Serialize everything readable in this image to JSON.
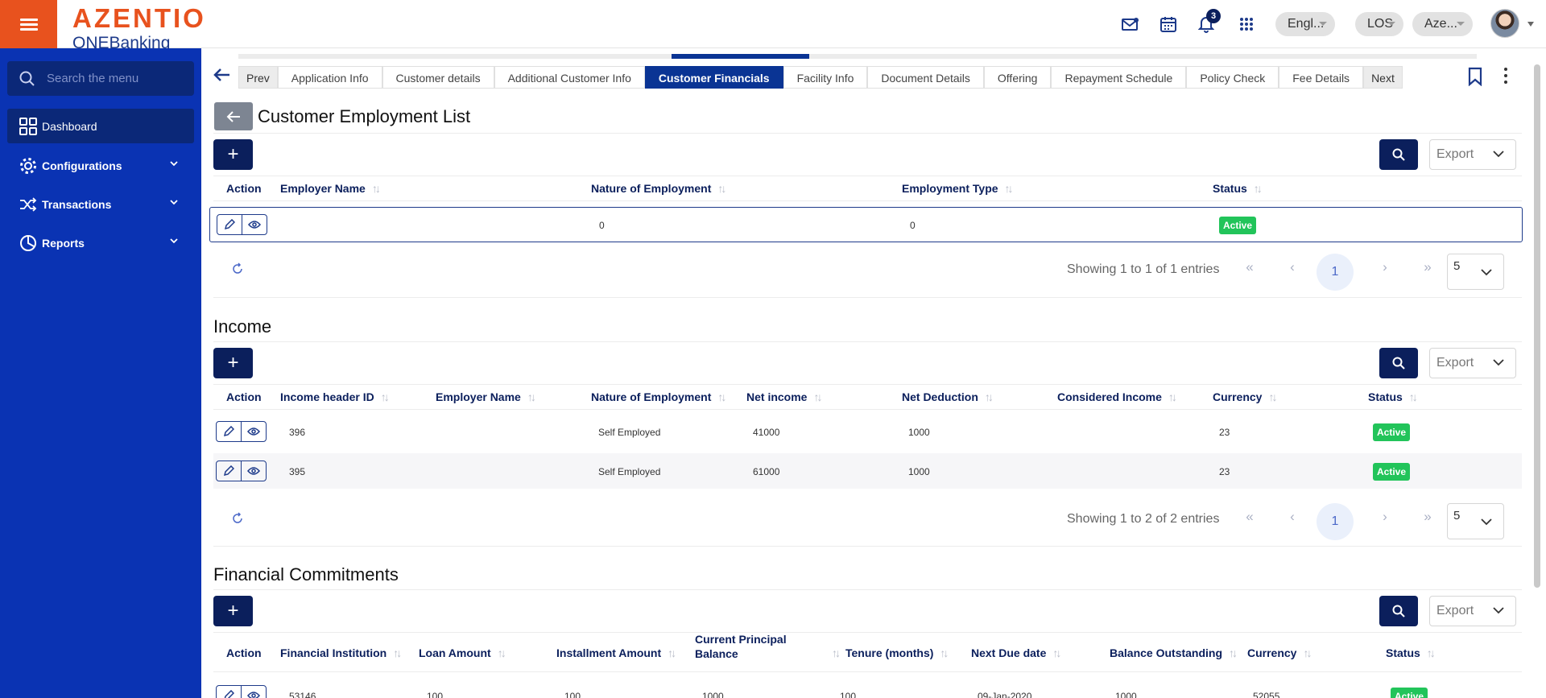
{
  "header": {
    "brand": "AZENTIO",
    "brand_sub_prefix": "ONE",
    "brand_sub_suffix": "Banking",
    "notification_count": "3",
    "language": "Engl...",
    "module": "LOS",
    "entity": "Aze..."
  },
  "sidebar": {
    "search_placeholder": "Search the menu",
    "items": [
      {
        "label": "Dashboard"
      },
      {
        "label": "Configurations"
      },
      {
        "label": "Transactions"
      },
      {
        "label": "Reports"
      }
    ]
  },
  "tabs": {
    "prev": "Prev",
    "next": "Next",
    "items": [
      "Application Info",
      "Customer details",
      "Additional Customer Info",
      "Customer Financials",
      "Facility Info",
      "Document Details",
      "Offering",
      "Repayment Schedule",
      "Policy Check",
      "Fee Details"
    ],
    "active": "Customer Financials"
  },
  "employment": {
    "title": "Customer Employment List",
    "export_label": "Export",
    "columns": [
      "Action",
      "Employer Name",
      "Nature of Employment",
      "Employment Type",
      "Status"
    ],
    "rows": [
      {
        "employer_name": "",
        "nature": "0",
        "type": "0",
        "status": "Active"
      }
    ],
    "pager": {
      "info": "Showing 1 to 1 of 1 entries",
      "page": "1",
      "size": "5"
    }
  },
  "income": {
    "title": "Income",
    "export_label": "Export",
    "columns": [
      "Action",
      "Income header ID",
      "Employer Name",
      "Nature of Employment",
      "Net income",
      "Net Deduction",
      "Considered Income",
      "Currency",
      "Status"
    ],
    "rows": [
      {
        "id": "396",
        "employer_name": "",
        "nature": "Self Employed",
        "net_income": "41000",
        "net_deduction": "1000",
        "considered": "",
        "currency": "23",
        "status": "Active"
      },
      {
        "id": "395",
        "employer_name": "",
        "nature": "Self Employed",
        "net_income": "61000",
        "net_deduction": "1000",
        "considered": "",
        "currency": "23",
        "status": "Active"
      }
    ],
    "pager": {
      "info": "Showing 1 to 2 of 2 entries",
      "page": "1",
      "size": "5"
    }
  },
  "commitments": {
    "title": "Financial Commitments",
    "export_label": "Export",
    "columns": [
      "Action",
      "Financial Institution",
      "Loan Amount",
      "Installment Amount",
      "Current Principal Balance",
      "Tenure (months)",
      "Next Due date",
      "Balance Outstanding",
      "Currency",
      "Status"
    ],
    "rows": [
      {
        "institution": "53146",
        "loan_amount": "100",
        "installment": "100",
        "principal": "1000",
        "tenure": "100",
        "due_date": "09-Jan-2020",
        "balance": "1000",
        "currency": "52055",
        "status": "Active"
      }
    ]
  }
}
